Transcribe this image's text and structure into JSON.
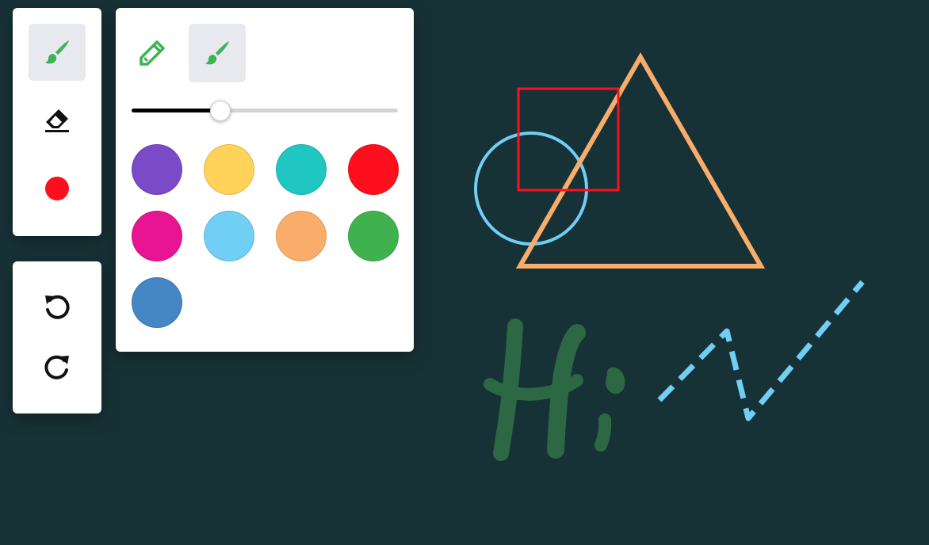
{
  "colors": {
    "background": "#173237",
    "accent_green": "#3cb453",
    "icon_dark": "#111111",
    "active_color": "#ff0f1e",
    "active_tool_bg": "#e8e9ee"
  },
  "toolbar": {
    "tools": [
      {
        "name": "brush-tool",
        "icon": "brush-icon",
        "active": true
      },
      {
        "name": "eraser-tool",
        "icon": "eraser-icon",
        "active": false
      },
      {
        "name": "color-tool",
        "icon": "color-dot-icon",
        "active": false
      }
    ]
  },
  "history": {
    "undo_icon": "undo-icon",
    "redo_icon": "redo-icon"
  },
  "brush_panel": {
    "brush_types": [
      {
        "name": "pencil",
        "icon": "pencil-icon",
        "active": false
      },
      {
        "name": "brush",
        "icon": "brush-icon",
        "active": true
      }
    ],
    "stroke_size_fraction": 0.33,
    "palette": [
      {
        "name": "purple",
        "color": "#7b4ac9"
      },
      {
        "name": "yellow",
        "color": "#ffd25a"
      },
      {
        "name": "teal",
        "color": "#20c6c2"
      },
      {
        "name": "red",
        "color": "#ff0f1e",
        "selected": true
      },
      {
        "name": "magenta",
        "color": "#e91493"
      },
      {
        "name": "light-blue",
        "color": "#71cef4"
      },
      {
        "name": "orange",
        "color": "#f9ad6a"
      },
      {
        "name": "green",
        "color": "#3fb24f"
      },
      {
        "name": "blue",
        "color": "#4587c4"
      }
    ]
  },
  "drawing": {
    "shapes": [
      {
        "type": "circle",
        "color": "#71cef4"
      },
      {
        "type": "rectangle",
        "color": "#ff0f1e"
      },
      {
        "type": "triangle",
        "color": "#f9ad6a"
      },
      {
        "type": "dashed-zigzag-line",
        "color": "#71cef4"
      },
      {
        "type": "handwriting",
        "text": "Hi",
        "color": "#2d6b44"
      }
    ]
  }
}
